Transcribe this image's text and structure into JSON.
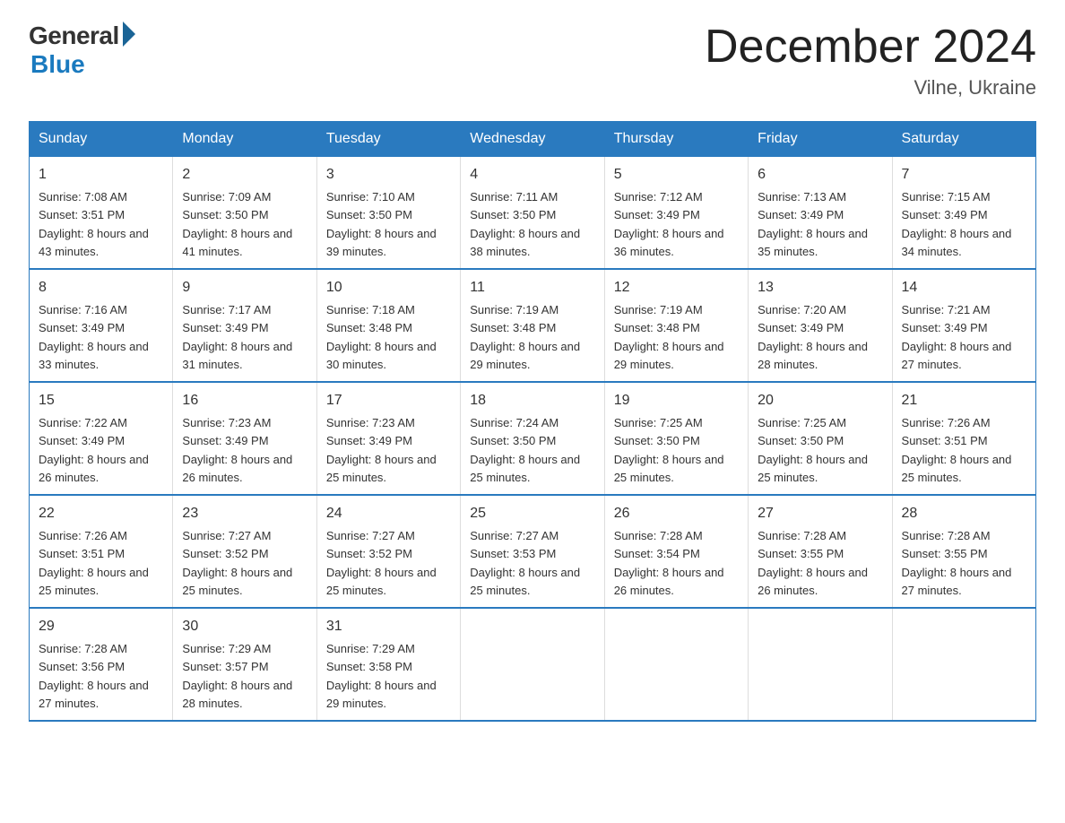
{
  "logo": {
    "general": "General",
    "blue": "Blue"
  },
  "title": "December 2024",
  "location": "Vilne, Ukraine",
  "days_of_week": [
    "Sunday",
    "Monday",
    "Tuesday",
    "Wednesday",
    "Thursday",
    "Friday",
    "Saturday"
  ],
  "weeks": [
    [
      {
        "num": "1",
        "sunrise": "Sunrise: 7:08 AM",
        "sunset": "Sunset: 3:51 PM",
        "daylight": "Daylight: 8 hours and 43 minutes."
      },
      {
        "num": "2",
        "sunrise": "Sunrise: 7:09 AM",
        "sunset": "Sunset: 3:50 PM",
        "daylight": "Daylight: 8 hours and 41 minutes."
      },
      {
        "num": "3",
        "sunrise": "Sunrise: 7:10 AM",
        "sunset": "Sunset: 3:50 PM",
        "daylight": "Daylight: 8 hours and 39 minutes."
      },
      {
        "num": "4",
        "sunrise": "Sunrise: 7:11 AM",
        "sunset": "Sunset: 3:50 PM",
        "daylight": "Daylight: 8 hours and 38 minutes."
      },
      {
        "num": "5",
        "sunrise": "Sunrise: 7:12 AM",
        "sunset": "Sunset: 3:49 PM",
        "daylight": "Daylight: 8 hours and 36 minutes."
      },
      {
        "num": "6",
        "sunrise": "Sunrise: 7:13 AM",
        "sunset": "Sunset: 3:49 PM",
        "daylight": "Daylight: 8 hours and 35 minutes."
      },
      {
        "num": "7",
        "sunrise": "Sunrise: 7:15 AM",
        "sunset": "Sunset: 3:49 PM",
        "daylight": "Daylight: 8 hours and 34 minutes."
      }
    ],
    [
      {
        "num": "8",
        "sunrise": "Sunrise: 7:16 AM",
        "sunset": "Sunset: 3:49 PM",
        "daylight": "Daylight: 8 hours and 33 minutes."
      },
      {
        "num": "9",
        "sunrise": "Sunrise: 7:17 AM",
        "sunset": "Sunset: 3:49 PM",
        "daylight": "Daylight: 8 hours and 31 minutes."
      },
      {
        "num": "10",
        "sunrise": "Sunrise: 7:18 AM",
        "sunset": "Sunset: 3:48 PM",
        "daylight": "Daylight: 8 hours and 30 minutes."
      },
      {
        "num": "11",
        "sunrise": "Sunrise: 7:19 AM",
        "sunset": "Sunset: 3:48 PM",
        "daylight": "Daylight: 8 hours and 29 minutes."
      },
      {
        "num": "12",
        "sunrise": "Sunrise: 7:19 AM",
        "sunset": "Sunset: 3:48 PM",
        "daylight": "Daylight: 8 hours and 29 minutes."
      },
      {
        "num": "13",
        "sunrise": "Sunrise: 7:20 AM",
        "sunset": "Sunset: 3:49 PM",
        "daylight": "Daylight: 8 hours and 28 minutes."
      },
      {
        "num": "14",
        "sunrise": "Sunrise: 7:21 AM",
        "sunset": "Sunset: 3:49 PM",
        "daylight": "Daylight: 8 hours and 27 minutes."
      }
    ],
    [
      {
        "num": "15",
        "sunrise": "Sunrise: 7:22 AM",
        "sunset": "Sunset: 3:49 PM",
        "daylight": "Daylight: 8 hours and 26 minutes."
      },
      {
        "num": "16",
        "sunrise": "Sunrise: 7:23 AM",
        "sunset": "Sunset: 3:49 PM",
        "daylight": "Daylight: 8 hours and 26 minutes."
      },
      {
        "num": "17",
        "sunrise": "Sunrise: 7:23 AM",
        "sunset": "Sunset: 3:49 PM",
        "daylight": "Daylight: 8 hours and 25 minutes."
      },
      {
        "num": "18",
        "sunrise": "Sunrise: 7:24 AM",
        "sunset": "Sunset: 3:50 PM",
        "daylight": "Daylight: 8 hours and 25 minutes."
      },
      {
        "num": "19",
        "sunrise": "Sunrise: 7:25 AM",
        "sunset": "Sunset: 3:50 PM",
        "daylight": "Daylight: 8 hours and 25 minutes."
      },
      {
        "num": "20",
        "sunrise": "Sunrise: 7:25 AM",
        "sunset": "Sunset: 3:50 PM",
        "daylight": "Daylight: 8 hours and 25 minutes."
      },
      {
        "num": "21",
        "sunrise": "Sunrise: 7:26 AM",
        "sunset": "Sunset: 3:51 PM",
        "daylight": "Daylight: 8 hours and 25 minutes."
      }
    ],
    [
      {
        "num": "22",
        "sunrise": "Sunrise: 7:26 AM",
        "sunset": "Sunset: 3:51 PM",
        "daylight": "Daylight: 8 hours and 25 minutes."
      },
      {
        "num": "23",
        "sunrise": "Sunrise: 7:27 AM",
        "sunset": "Sunset: 3:52 PM",
        "daylight": "Daylight: 8 hours and 25 minutes."
      },
      {
        "num": "24",
        "sunrise": "Sunrise: 7:27 AM",
        "sunset": "Sunset: 3:52 PM",
        "daylight": "Daylight: 8 hours and 25 minutes."
      },
      {
        "num": "25",
        "sunrise": "Sunrise: 7:27 AM",
        "sunset": "Sunset: 3:53 PM",
        "daylight": "Daylight: 8 hours and 25 minutes."
      },
      {
        "num": "26",
        "sunrise": "Sunrise: 7:28 AM",
        "sunset": "Sunset: 3:54 PM",
        "daylight": "Daylight: 8 hours and 26 minutes."
      },
      {
        "num": "27",
        "sunrise": "Sunrise: 7:28 AM",
        "sunset": "Sunset: 3:55 PM",
        "daylight": "Daylight: 8 hours and 26 minutes."
      },
      {
        "num": "28",
        "sunrise": "Sunrise: 7:28 AM",
        "sunset": "Sunset: 3:55 PM",
        "daylight": "Daylight: 8 hours and 27 minutes."
      }
    ],
    [
      {
        "num": "29",
        "sunrise": "Sunrise: 7:28 AM",
        "sunset": "Sunset: 3:56 PM",
        "daylight": "Daylight: 8 hours and 27 minutes."
      },
      {
        "num": "30",
        "sunrise": "Sunrise: 7:29 AM",
        "sunset": "Sunset: 3:57 PM",
        "daylight": "Daylight: 8 hours and 28 minutes."
      },
      {
        "num": "31",
        "sunrise": "Sunrise: 7:29 AM",
        "sunset": "Sunset: 3:58 PM",
        "daylight": "Daylight: 8 hours and 29 minutes."
      },
      null,
      null,
      null,
      null
    ]
  ]
}
